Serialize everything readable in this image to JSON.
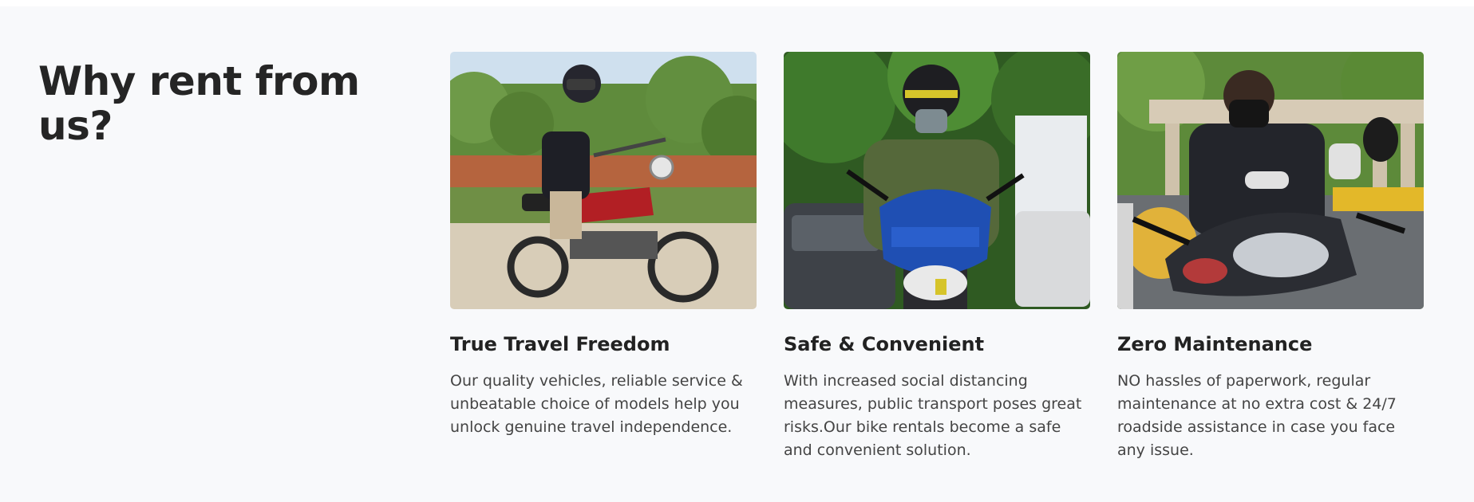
{
  "section": {
    "heading": "Why rent from us?",
    "cards": [
      {
        "image_icon": "motorcycle-rider-photo",
        "title": "True Travel Freedom",
        "text": "Our quality vehicles, reliable service & unbeatable choice of models help you unlock genuine travel independence."
      },
      {
        "image_icon": "scooter-rider-photo",
        "title": "Safe & Convenient",
        "text": "With increased social distancing measures, public transport poses great risks.Our bike rentals become a safe and convenient solution."
      },
      {
        "image_icon": "maintenance-photo",
        "title": "Zero Maintenance",
        "text": "NO hassles of paperwork, regular maintenance at no extra cost & 24/7 roadside assistance in case you face any issue."
      }
    ]
  }
}
